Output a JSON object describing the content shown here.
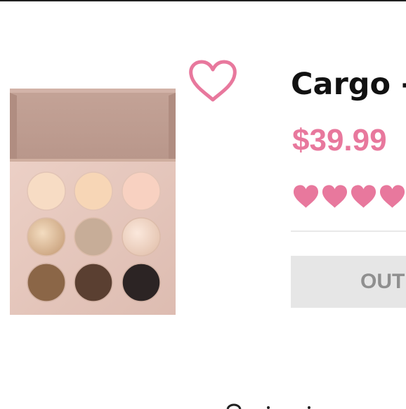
{
  "product": {
    "title": "Cargo -",
    "price": "$39.99",
    "rating": {
      "value": 4,
      "max": 5
    },
    "stock_button_label": "OUT"
  },
  "icons": {
    "wishlist": "heart-outline-icon",
    "rating": "heart-filled-icon"
  },
  "colors": {
    "accent": "#e8789d",
    "title": "#111111",
    "button_bg": "#e6e6e6",
    "button_text": "#8f8f8f",
    "palette_case": "#c7a59a",
    "palette_tray": "#e7c9bf"
  }
}
